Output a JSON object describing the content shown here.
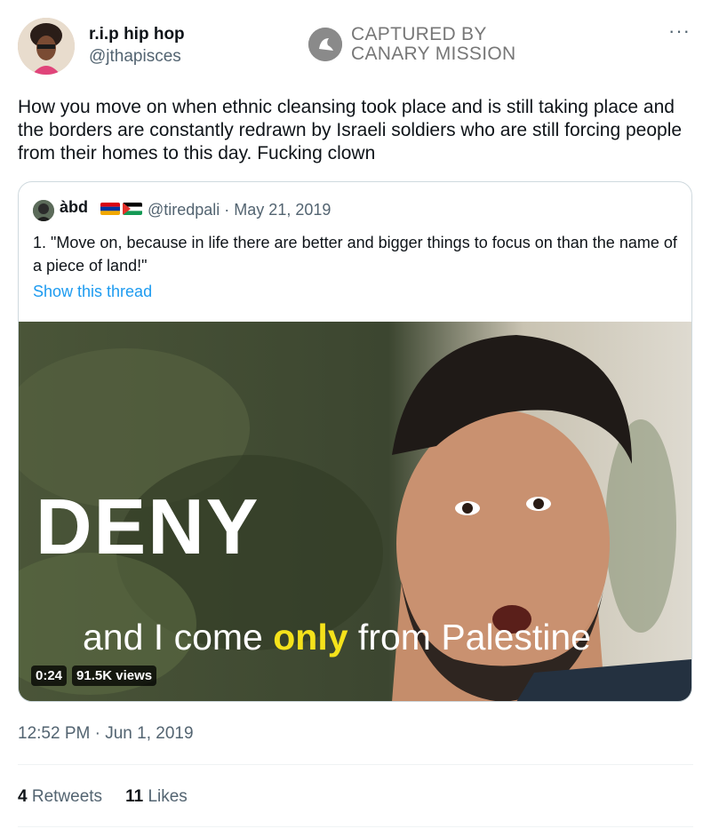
{
  "author": {
    "name": "r.i.p hip hop",
    "handle": "@jthapisces"
  },
  "watermark": {
    "line1": "CAPTURED BY",
    "line2": "CANARY MISSION"
  },
  "menu": {
    "more_label": "···"
  },
  "tweet": {
    "text": "How you move on when ethnic cleansing took place and is still taking place and the borders are constantly redrawn by Israeli soldiers who are still forcing people from their homes to this day. Fucking clown",
    "timestamp": "12:52 PM · Jun 1, 2019"
  },
  "quote": {
    "name": "àbd",
    "meta": "@tiredpali · May 21, 2019",
    "text": "1. \"Move on, because in life there are better and bigger things to focus on than the name of a piece of land!\"",
    "link": "Show this thread"
  },
  "video": {
    "caption_main": "DENY",
    "caption_before": "and I come ",
    "caption_highlight": "only",
    "caption_after": " from Palestine",
    "duration": "0:24",
    "views": "91.5K views"
  },
  "stats": {
    "retweets_count": "4",
    "retweets_label": "Retweets",
    "likes_count": "11",
    "likes_label": "Likes"
  },
  "colors": {
    "link": "#1d9bf0",
    "secondary": "#536471",
    "highlight": "#f5e21b"
  }
}
